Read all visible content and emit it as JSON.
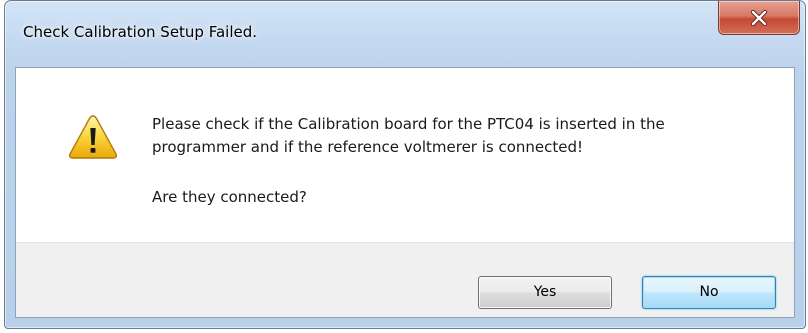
{
  "dialog": {
    "title": "Check Calibration Setup Failed.",
    "icon": "warning-icon",
    "message_lines": [
      "Please check if the Calibration board for the PTC04 is inserted in the",
      "programmer and if the reference voltmerer is connected!"
    ],
    "question": "Are they connected?",
    "buttons": {
      "yes_label": "Yes",
      "no_label": "No"
    },
    "colors": {
      "close_button": "#c44a33",
      "default_button_border": "#3c7fb1",
      "button_bar": "#f0f0f0",
      "frame": "#bcd3ec"
    }
  }
}
